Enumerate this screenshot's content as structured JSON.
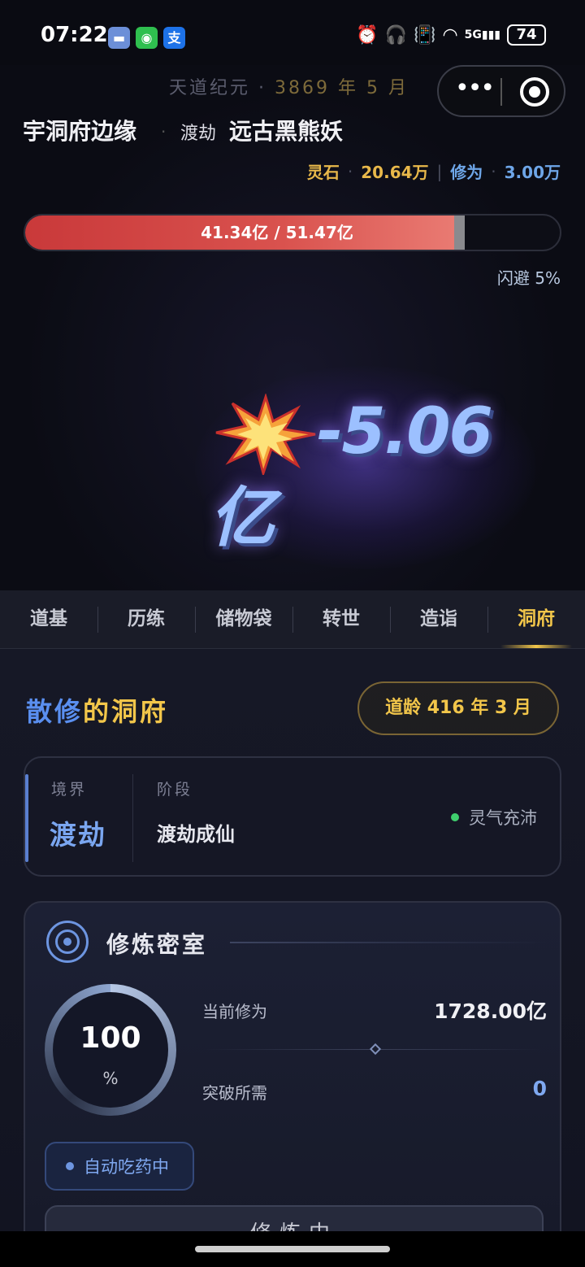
{
  "status_bar": {
    "time": "07:22",
    "app_icons": [
      "message-app",
      "wechat",
      "alipay"
    ],
    "alipay_glyph": "支",
    "battery": "74",
    "signal_label": "5G"
  },
  "header": {
    "era_prefix": "天道纪元 · ",
    "era_date": "3869 年 5 月",
    "location": "宇洞府边缘",
    "dot": "·",
    "realm": "渡劫",
    "enemy_name": "远古黑熊妖"
  },
  "resources": {
    "spirit_stone_label": "灵石",
    "spirit_stone_value": "20.64万",
    "cultivation_label": "修为",
    "cultivation_value": "3.00万",
    "dot": "·",
    "divider": "|"
  },
  "enemy_hp": {
    "text": "41.34亿 / 51.47亿",
    "current": 41.34,
    "max": 51.47,
    "recent_damage": 5.06,
    "dodge_text": "闪避 5%"
  },
  "damage_popup": {
    "value": "-5.06",
    "unit": "亿"
  },
  "tabs": [
    {
      "label": "道基",
      "active": false
    },
    {
      "label": "历练",
      "active": false
    },
    {
      "label": "储物袋",
      "active": false
    },
    {
      "label": "转世",
      "active": false
    },
    {
      "label": "造诣",
      "active": false
    },
    {
      "label": "洞府",
      "active": true
    }
  ],
  "cave": {
    "owner": "散修",
    "title_suffix": "的洞府",
    "age_text": "道龄 416 年 3 月",
    "realm_label": "境界",
    "realm_value": "渡劫",
    "stage_label": "阶段",
    "stage_value": "渡劫成仙",
    "qi_status": "灵气充沛"
  },
  "cultivation_room": {
    "title": "修炼密室",
    "progress_value": "100",
    "progress_unit": "%",
    "progress_fraction": 1.0,
    "current_label": "当前修为",
    "current_value": "1728.00亿",
    "breakthrough_label": "突破所需",
    "breakthrough_value": "0",
    "auto_pill_text": "自动吃药中",
    "bottom_button_text": "修炼中"
  },
  "colors": {
    "gold": "#f2c64a",
    "blue": "#6ea6e8",
    "hp_red": "#d9524e",
    "qi_green": "#3fcf6e",
    "damage_blue": "#9cc0ff"
  }
}
